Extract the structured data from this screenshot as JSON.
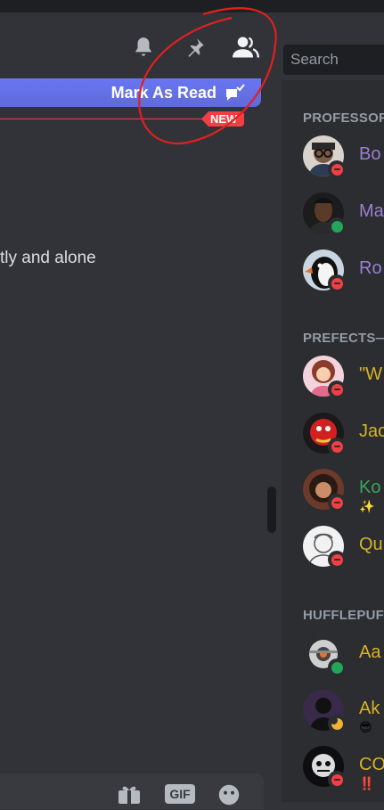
{
  "header": {
    "search_placeholder": "Search",
    "icons": [
      "bell-icon",
      "pin-icon",
      "members-icon"
    ]
  },
  "banner": {
    "mark_as_read_label": "Mark As Read",
    "new_badge": "NEW"
  },
  "chat": {
    "visible_text": "tly and alone"
  },
  "composer": {
    "gif_label": "GIF"
  },
  "members": {
    "sections": [
      {
        "title": "PROFESSOR",
        "items": [
          {
            "name": "Bo",
            "status": "dnd",
            "color": "#9b7fd0"
          },
          {
            "name": "Ma",
            "status": "online",
            "color": "#9b7fd0"
          },
          {
            "name": "Ro",
            "status": "dnd",
            "color": "#9b7fd0"
          }
        ]
      },
      {
        "title": "PREFECTS—",
        "items": [
          {
            "name": "\"W",
            "status": "dnd",
            "color": "#d8b327"
          },
          {
            "name": "Jac",
            "status": "dnd",
            "color": "#d8b327"
          },
          {
            "name": "Ko",
            "status": "dnd",
            "color": "#3ba55d",
            "sub": "✨"
          },
          {
            "name": "Qu",
            "status": "dnd",
            "color": "#d8b327"
          }
        ]
      },
      {
        "title": "HUFFLEPUFF",
        "items": [
          {
            "name": "Aa",
            "status": "online",
            "color": "#d8b327"
          },
          {
            "name": "Ak",
            "status": "idle",
            "color": "#d8b327",
            "sub": "😎"
          },
          {
            "name": "CO",
            "status": "dnd",
            "color": "#d8b327",
            "sub": "‼️"
          }
        ]
      }
    ]
  },
  "colors": {
    "accent": "#5865f2",
    "danger": "#f23f43",
    "annotation": "#e02020"
  }
}
